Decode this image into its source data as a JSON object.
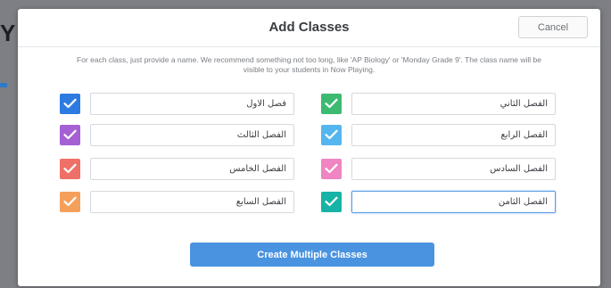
{
  "modal": {
    "title": "Add Classes",
    "cancel_label": "Cancel",
    "description": "For each class, just provide a name. We recommend something not too long, like 'AP Biology' or 'Monday Grade 9'. The class name will be visible to your students in Now Playing.",
    "create_label": "Create Multiple Classes"
  },
  "classes": [
    {
      "name": "فصل الاول",
      "color": "#2d7be0",
      "checked": true,
      "icon": "check-icon"
    },
    {
      "name": "الفصل الثاني",
      "color": "#3cba72",
      "checked": true,
      "icon": "check-icon"
    },
    {
      "name": "الفصل الثالث",
      "color": "#a560d4",
      "checked": true,
      "icon": "check-icon"
    },
    {
      "name": "الفصل الرابع",
      "color": "#55b6ef",
      "checked": true,
      "icon": "check-icon"
    },
    {
      "name": "الفصل الخامس",
      "color": "#ef7067",
      "checked": true,
      "icon": "check-icon"
    },
    {
      "name": "الفصل السادس",
      "color": "#ef85c2",
      "checked": true,
      "icon": "check-icon"
    },
    {
      "name": "الفصل السابع",
      "color": "#f5a05a",
      "checked": true,
      "icon": "check-icon"
    },
    {
      "name": "الفصل الثامن",
      "color": "#17b3a6",
      "checked": true,
      "icon": "check-icon",
      "focused": true
    }
  ],
  "colors": {
    "primary_button": "#4a93e0",
    "focus_border": "#5b9be6"
  }
}
